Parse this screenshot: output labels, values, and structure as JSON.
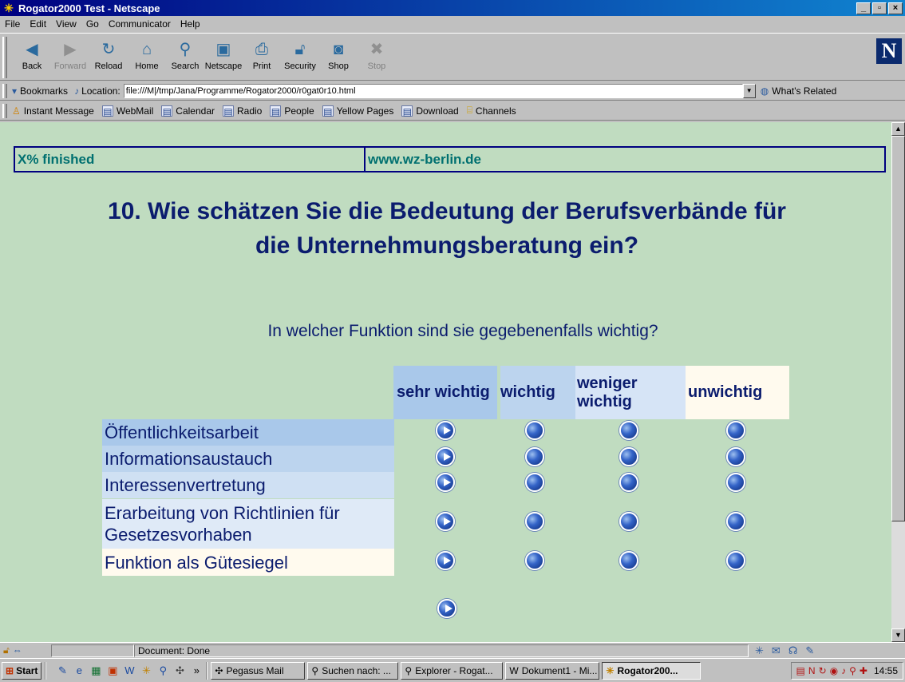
{
  "window": {
    "title": "Rogator2000 Test - Netscape",
    "controls": [
      "_",
      "▫",
      "×"
    ]
  },
  "menu": [
    "File",
    "Edit",
    "View",
    "Go",
    "Communicator",
    "Help"
  ],
  "toolbar": {
    "buttons": [
      {
        "label": "Back",
        "icon": "back-arrow-icon",
        "enabled": true
      },
      {
        "label": "Forward",
        "icon": "forward-arrow-icon",
        "enabled": false
      },
      {
        "label": "Reload",
        "icon": "reload-icon",
        "enabled": true
      },
      {
        "label": "Home",
        "icon": "home-icon",
        "enabled": true
      },
      {
        "label": "Search",
        "icon": "search-icon",
        "enabled": true
      },
      {
        "label": "Netscape",
        "icon": "netscape-icon",
        "enabled": true
      },
      {
        "label": "Print",
        "icon": "print-icon",
        "enabled": true
      },
      {
        "label": "Security",
        "icon": "security-lock-icon",
        "enabled": true
      },
      {
        "label": "Shop",
        "icon": "shop-icon",
        "enabled": true
      },
      {
        "label": "Stop",
        "icon": "stop-icon",
        "enabled": false
      }
    ]
  },
  "location": {
    "bookmarks_label": "Bookmarks",
    "location_label": "Location:",
    "url": "file:///M|/tmp/Jana/Programme/Rogator2000/r0gat0r10.html",
    "related_label": "What's Related"
  },
  "personal_toolbar": [
    "Instant Message",
    "WebMail",
    "Calendar",
    "Radio",
    "People",
    "Yellow Pages",
    "Download",
    "Channels"
  ],
  "page": {
    "progress_text": "X% finished",
    "site": "www.wz-berlin.de",
    "question": "10. Wie schätzen Sie die Bedeutung der Berufsverbände für die Unternehmungsberatung ein?",
    "subquestion": "In welcher Funktion sind sie gegebenenfalls wichtig?",
    "columns": [
      "sehr wichtig",
      "wichtig",
      "weniger wichtig",
      "unwichtig"
    ],
    "rows": [
      {
        "label": "Öffentlichkeitsarbeit",
        "selected": 0
      },
      {
        "label": "Informationsaustauch",
        "selected": 0
      },
      {
        "label": "Interessenvertretung",
        "selected": 0
      },
      {
        "label": "Erarbeitung von Richtlinien für Gesetzesvorhaben",
        "selected": 0
      },
      {
        "label": "Funktion als Gütesiegel",
        "selected": 0
      }
    ]
  },
  "statusbar": {
    "text": "Document: Done"
  },
  "taskbar": {
    "start_label": "Start",
    "tasks": [
      {
        "label": "Pegasus Mail",
        "active": false
      },
      {
        "label": "Suchen nach: ...",
        "active": false
      },
      {
        "label": "Explorer - Rogat...",
        "active": false
      },
      {
        "label": "Dokument1 - Mi...",
        "active": false
      },
      {
        "label": "Rogator200...",
        "active": true
      }
    ],
    "clock": "14:55"
  },
  "colors": {
    "page_background": "#c0dcc0",
    "text_navy": "#0b1c6e",
    "status_teal": "#007070",
    "titlebar": "#000080"
  }
}
